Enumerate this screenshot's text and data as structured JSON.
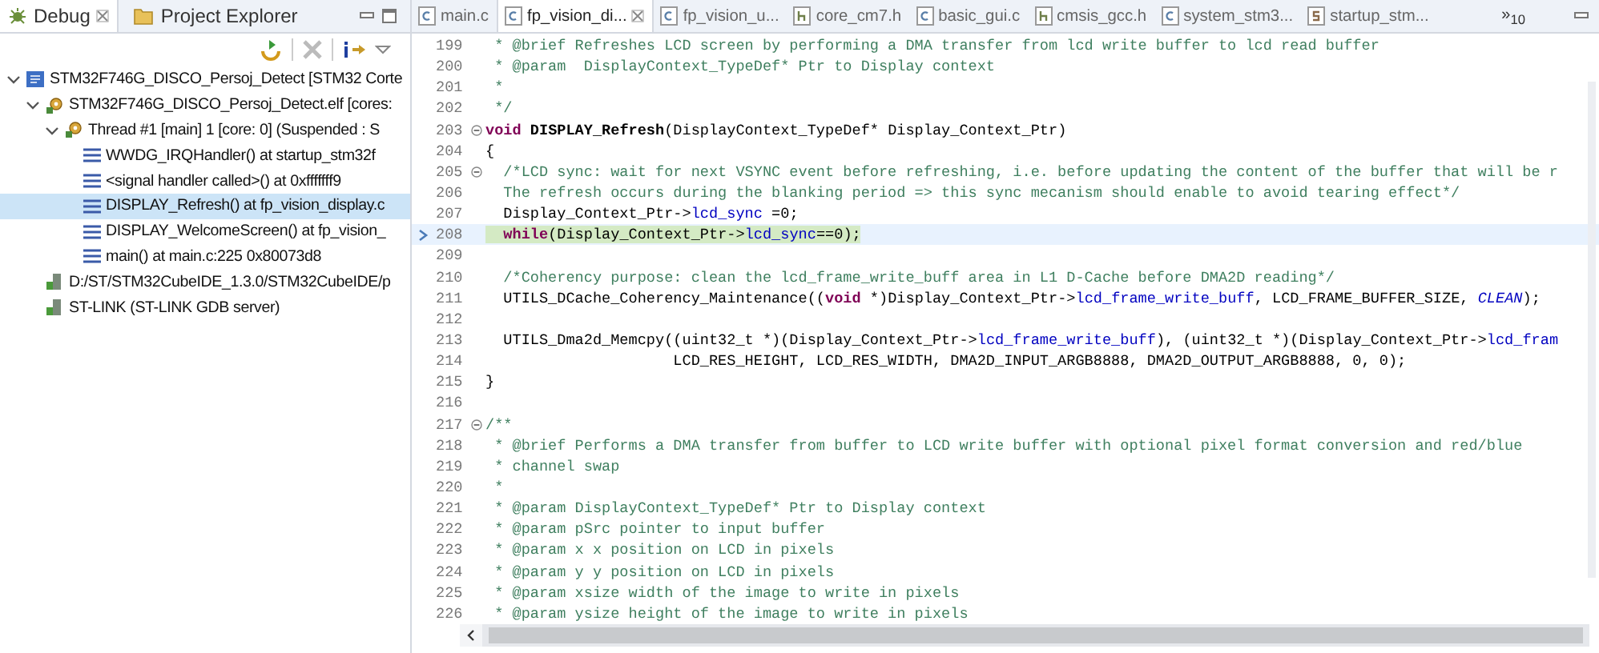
{
  "debug_panel": {
    "tabs": [
      {
        "label": "Debug",
        "selected": true,
        "kind": "debug"
      },
      {
        "label": "Project Explorer",
        "selected": false,
        "kind": "project"
      }
    ],
    "tree": [
      {
        "label": "STM32F746G_DISCO_Persoj_Detect [STM32 Corte",
        "kind": "launch",
        "expanded": true,
        "selected": false,
        "children": [
          {
            "label": "STM32F746G_DISCO_Persoj_Detect.elf [cores:",
            "kind": "process",
            "expanded": true,
            "selected": false,
            "children": [
              {
                "label": "Thread #1 [main] 1 [core: 0] (Suspended : S",
                "kind": "thread",
                "expanded": true,
                "selected": false,
                "children": [
                  {
                    "label": "WWDG_IRQHandler() at startup_stm32f",
                    "kind": "frame",
                    "selected": false
                  },
                  {
                    "label": "<signal handler called>() at 0xfffffff9",
                    "kind": "frame",
                    "selected": false
                  },
                  {
                    "label": "DISPLAY_Refresh() at fp_vision_display.c",
                    "kind": "frame",
                    "selected": true
                  },
                  {
                    "label": "DISPLAY_WelcomeScreen() at fp_vision_",
                    "kind": "frame",
                    "selected": false
                  },
                  {
                    "label": "main() at main.c:225 0x80073d8",
                    "kind": "frame",
                    "selected": false
                  }
                ]
              }
            ]
          },
          {
            "label": "D:/ST/STM32CubeIDE_1.3.0/STM32CubeIDE/p",
            "kind": "gdb",
            "selected": false
          },
          {
            "label": "ST-LINK (ST-LINK GDB server)",
            "kind": "gdb",
            "selected": false
          }
        ]
      }
    ]
  },
  "editor": {
    "tabs": [
      {
        "label": "main.c",
        "kind": "c",
        "selected": false
      },
      {
        "label": "fp_vision_di...",
        "kind": "c",
        "selected": true
      },
      {
        "label": "fp_vision_u...",
        "kind": "c",
        "selected": false
      },
      {
        "label": "core_cm7.h",
        "kind": "h",
        "selected": false
      },
      {
        "label": "basic_gui.c",
        "kind": "c",
        "selected": false
      },
      {
        "label": "cmsis_gcc.h",
        "kind": "h",
        "selected": false
      },
      {
        "label": "system_stm3...",
        "kind": "c",
        "selected": false
      },
      {
        "label": "startup_stm...",
        "kind": "s",
        "selected": false
      }
    ],
    "overflow": "»$_{10}$",
    "lines": [
      {
        "number": "199",
        "current": false,
        "foldable": false,
        "segments": [
          {
            "kind": "comment",
            "text": " * @brief Refreshes LCD screen by performing a DMA transfer from lcd write buffer to lcd read buffer"
          }
        ]
      },
      {
        "number": "200",
        "current": false,
        "foldable": false,
        "segments": [
          {
            "kind": "comment",
            "text": " * @param  DisplayContext_TypeDef* Ptr to Display context"
          }
        ]
      },
      {
        "number": "201",
        "current": false,
        "foldable": false,
        "segments": [
          {
            "kind": "comment",
            "text": " *"
          }
        ]
      },
      {
        "number": "202",
        "current": false,
        "foldable": false,
        "segments": [
          {
            "kind": "comment",
            "text": " */"
          }
        ]
      },
      {
        "number": "203",
        "current": false,
        "foldable": true,
        "segments": [
          {
            "kind": "keyword",
            "text": "void"
          },
          {
            "kind": "bold",
            "text": " DISPLAY_Refresh"
          },
          {
            "kind": "plain",
            "text": "(DisplayContext_TypeDef* Display_Context_Ptr)"
          }
        ]
      },
      {
        "number": "204",
        "current": false,
        "foldable": false,
        "segments": [
          {
            "kind": "plain",
            "text": "{"
          }
        ]
      },
      {
        "number": "205",
        "current": false,
        "foldable": true,
        "segments": [
          {
            "kind": "comment",
            "text": "  /*LCD sync: wait for next VSYNC event before refreshing, i.e. before updating the content of the buffer that will be r"
          }
        ]
      },
      {
        "number": "206",
        "current": false,
        "foldable": false,
        "segments": [
          {
            "kind": "comment",
            "text": "  The refresh occurs during the blanking period => this sync mecanism should enable to avoid tearing effect*/"
          }
        ]
      },
      {
        "number": "207",
        "current": false,
        "foldable": false,
        "segments": [
          {
            "kind": "plain",
            "text": "  Display_Context_Ptr->"
          },
          {
            "kind": "field",
            "text": "lcd_sync"
          },
          {
            "kind": "plain",
            "text": " =0;"
          }
        ]
      },
      {
        "number": "208",
        "current": true,
        "foldable": false,
        "segments": [
          {
            "kind": "keyword",
            "text": "  while"
          },
          {
            "kind": "plain",
            "text": "(Display_Context_Ptr->"
          },
          {
            "kind": "field",
            "text": "lcd_sync"
          },
          {
            "kind": "plain",
            "text": "==0);"
          }
        ]
      },
      {
        "number": "209",
        "current": false,
        "foldable": false
      },
      {
        "number": "210",
        "current": false,
        "foldable": false,
        "segments": [
          {
            "kind": "comment",
            "text": "  /*Coherency purpose: clean the lcd_frame_write_buff area in L1 D-Cache before DMA2D reading*/"
          }
        ]
      },
      {
        "number": "211",
        "current": false,
        "foldable": false,
        "segments": [
          {
            "kind": "plain",
            "text": "  UTILS_DCache_Coherency_Maintenance(("
          },
          {
            "kind": "keyword",
            "text": "void"
          },
          {
            "kind": "plain",
            "text": " *)Display_Context_Ptr->"
          },
          {
            "kind": "field",
            "text": "lcd_frame_write_buff"
          },
          {
            "kind": "plain",
            "text": ", LCD_FRAME_BUFFER_SIZE, "
          },
          {
            "kind": "constant",
            "text": "CLEAN"
          },
          {
            "kind": "plain",
            "text": ");"
          }
        ]
      },
      {
        "number": "212",
        "current": false,
        "foldable": false
      },
      {
        "number": "213",
        "current": false,
        "foldable": false,
        "segments": [
          {
            "kind": "plain",
            "text": "  UTILS_Dma2d_Memcpy((uint32_t *)(Display_Context_Ptr->"
          },
          {
            "kind": "field",
            "text": "lcd_frame_write_buff"
          },
          {
            "kind": "plain",
            "text": "), (uint32_t *)(Display_Context_Ptr->"
          },
          {
            "kind": "field",
            "text": "lcd_fram"
          }
        ]
      },
      {
        "number": "214",
        "current": false,
        "foldable": false,
        "segments": [
          {
            "kind": "plain",
            "text": "                     LCD_RES_HEIGHT, LCD_RES_WIDTH, DMA2D_INPUT_ARGB8888, DMA2D_OUTPUT_ARGB8888, 0, 0);"
          }
        ]
      },
      {
        "number": "215",
        "current": false,
        "foldable": false,
        "segments": [
          {
            "kind": "plain",
            "text": "}"
          }
        ]
      },
      {
        "number": "216",
        "current": false,
        "foldable": false
      },
      {
        "number": "217",
        "current": false,
        "foldable": true,
        "segments": [
          {
            "kind": "comment",
            "text": "/**"
          }
        ]
      },
      {
        "number": "218",
        "current": false,
        "foldable": false,
        "segments": [
          {
            "kind": "comment",
            "text": " * @brief Performs a DMA transfer from buffer to LCD write buffer with optional pixel format conversion and red/blue"
          }
        ]
      },
      {
        "number": "219",
        "current": false,
        "foldable": false,
        "segments": [
          {
            "kind": "comment",
            "text": " * channel swap"
          }
        ]
      },
      {
        "number": "220",
        "current": false,
        "foldable": false,
        "segments": [
          {
            "kind": "comment",
            "text": " *"
          }
        ]
      },
      {
        "number": "221",
        "current": false,
        "foldable": false,
        "segments": [
          {
            "kind": "comment",
            "text": " * @param DisplayContext_TypeDef* Ptr to Display context"
          }
        ]
      },
      {
        "number": "222",
        "current": false,
        "foldable": false,
        "segments": [
          {
            "kind": "comment",
            "text": " * @param pSrc pointer to input buffer"
          }
        ]
      },
      {
        "number": "223",
        "current": false,
        "foldable": false,
        "segments": [
          {
            "kind": "comment",
            "text": " * @param x x position on LCD in pixels"
          }
        ]
      },
      {
        "number": "224",
        "current": false,
        "foldable": false,
        "segments": [
          {
            "kind": "comment",
            "text": " * @param y y position on LCD in pixels"
          }
        ]
      },
      {
        "number": "225",
        "current": false,
        "foldable": false,
        "segments": [
          {
            "kind": "comment",
            "text": " * @param xsize width of the image to write in pixels"
          }
        ]
      },
      {
        "number": "226",
        "current": false,
        "foldable": false,
        "segments": [
          {
            "kind": "comment",
            "text": " * @param ysize height of the image to write in pixels"
          }
        ]
      }
    ]
  }
}
